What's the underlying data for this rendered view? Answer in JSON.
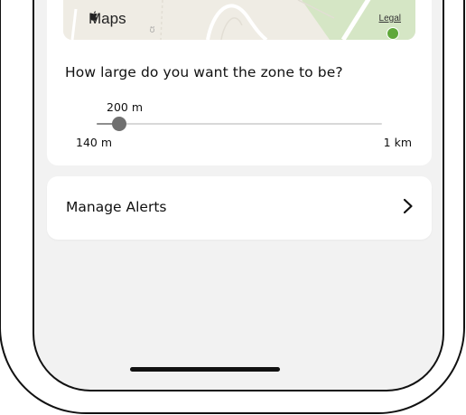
{
  "map": {
    "brand": "Maps",
    "legal": "Legal",
    "street_fragment": "Ct",
    "colors": {
      "land": "#efece4",
      "park": "#d5e6c5",
      "road": "#ffffff",
      "pin": "#5fa83a"
    }
  },
  "zone": {
    "question": "How large do you want the zone to be?",
    "slider": {
      "current_label": "200 m",
      "min_label": "140 m",
      "max_label": "1 km",
      "fraction": 0.08
    }
  },
  "alerts": {
    "label": "Manage Alerts",
    "icon": "chevron-right-icon"
  },
  "colors": {
    "screen_bg": "#f2f2f2",
    "card_bg": "#ffffff",
    "thumb": "#707070"
  }
}
